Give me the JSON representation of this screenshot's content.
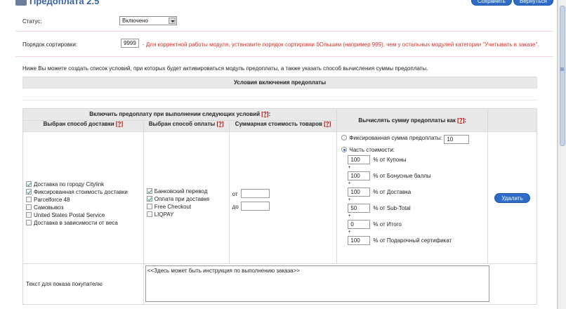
{
  "header": {
    "title": "Предоплата 2.5",
    "save_label": "Сохранить",
    "back_label": "Вернуться"
  },
  "status": {
    "label": "Статус:",
    "value": "Включено"
  },
  "sort_order": {
    "label": "Порядок сортировки:",
    "value": "9999",
    "hint": "- Для корректной работы модуля, установите порядок сортировки бОльшим (например 999), чем у остальных модулей категории \"Учитывать в заказе\"."
  },
  "intro_text": "Ниже Вы можете создать список условий, при которых будет активироваться модуль предоплаты, а также указать способ вычисления суммы предоплаты.",
  "conditions_bar": "Условия включения предоплаты",
  "table": {
    "enable_header": "Включить предоплату при выполнении следующих условий",
    "calc_header": "Вычислять сумму предоплаты как",
    "help_mark": "[?]",
    "help_suffix": ":",
    "col_shipping": "Выбран способ доставки",
    "col_payment": "Выбран способ оплаты",
    "col_total": "Суммарная стоимость товаров",
    "shipping": [
      {
        "label": "Доставка по городу Citylink",
        "checked": true
      },
      {
        "label": "Фиксированная стоимость доставки",
        "checked": true
      },
      {
        "label": "Parcelforce 48",
        "checked": false
      },
      {
        "label": "Самовывоз",
        "checked": false
      },
      {
        "label": "United States Postal Service",
        "checked": false
      },
      {
        "label": "Доставка в зависимости от веса",
        "checked": false
      }
    ],
    "payment": [
      {
        "label": "Банковский перевод",
        "checked": true
      },
      {
        "label": "Оплата при доставке",
        "checked": true
      },
      {
        "label": "Free Checkout",
        "checked": false
      },
      {
        "label": "LIQPAY",
        "checked": false
      }
    ],
    "total_from_label": "от",
    "total_to_label": "до",
    "fixed_label": "Фиксированная сумма предоплаты:",
    "fixed_value": "10",
    "part_label": "Часть стоимости:",
    "plus": "+",
    "parts": [
      {
        "value": "100",
        "label": "% от Купоны"
      },
      {
        "value": "100",
        "label": "% от Бонусные баллы"
      },
      {
        "value": "100",
        "label": "% от Доставка"
      },
      {
        "value": "50",
        "label": "% от Sub-Total"
      },
      {
        "value": "0",
        "label": "% от Итого"
      },
      {
        "value": "100",
        "label": "% от Подарочный сертификат"
      }
    ],
    "delete_label": "Удалить"
  },
  "customer_text": {
    "label": "Текст для показа покупателю",
    "value": "<<Здесь может быть инструкция по выполнению заказа>>"
  }
}
